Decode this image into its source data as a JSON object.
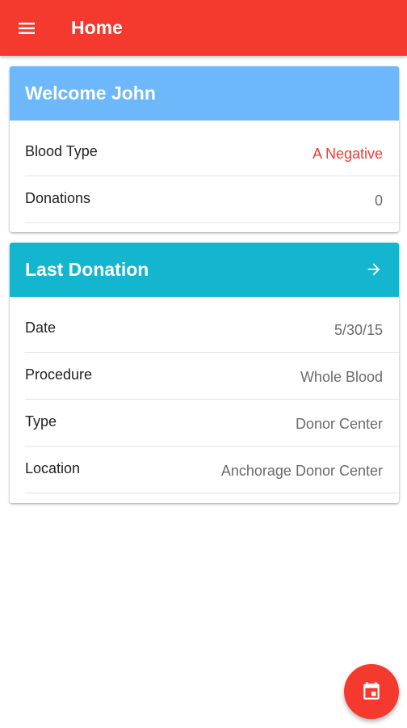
{
  "appbar": {
    "title": "Home",
    "menu_icon": "menu-icon",
    "color": "#f43a2f"
  },
  "welcome_card": {
    "title": "Welcome John",
    "header_color": "#6db8fb",
    "rows": [
      {
        "label": "Blood Type",
        "value": "A Negative",
        "value_color": "#f43a2f"
      },
      {
        "label": "Donations",
        "value": "0"
      }
    ]
  },
  "last_donation_card": {
    "title": "Last Donation",
    "header_color": "#13b5cf",
    "action_icon": "arrow-right-icon",
    "rows": [
      {
        "label": "Date",
        "value": "5/30/15"
      },
      {
        "label": "Procedure",
        "value": "Whole Blood"
      },
      {
        "label": "Type",
        "value": "Donor Center"
      },
      {
        "label": "Location",
        "value": "Anchorage Donor Center"
      }
    ]
  },
  "fab": {
    "icon": "calendar-event-icon",
    "color": "#f43a2f"
  }
}
